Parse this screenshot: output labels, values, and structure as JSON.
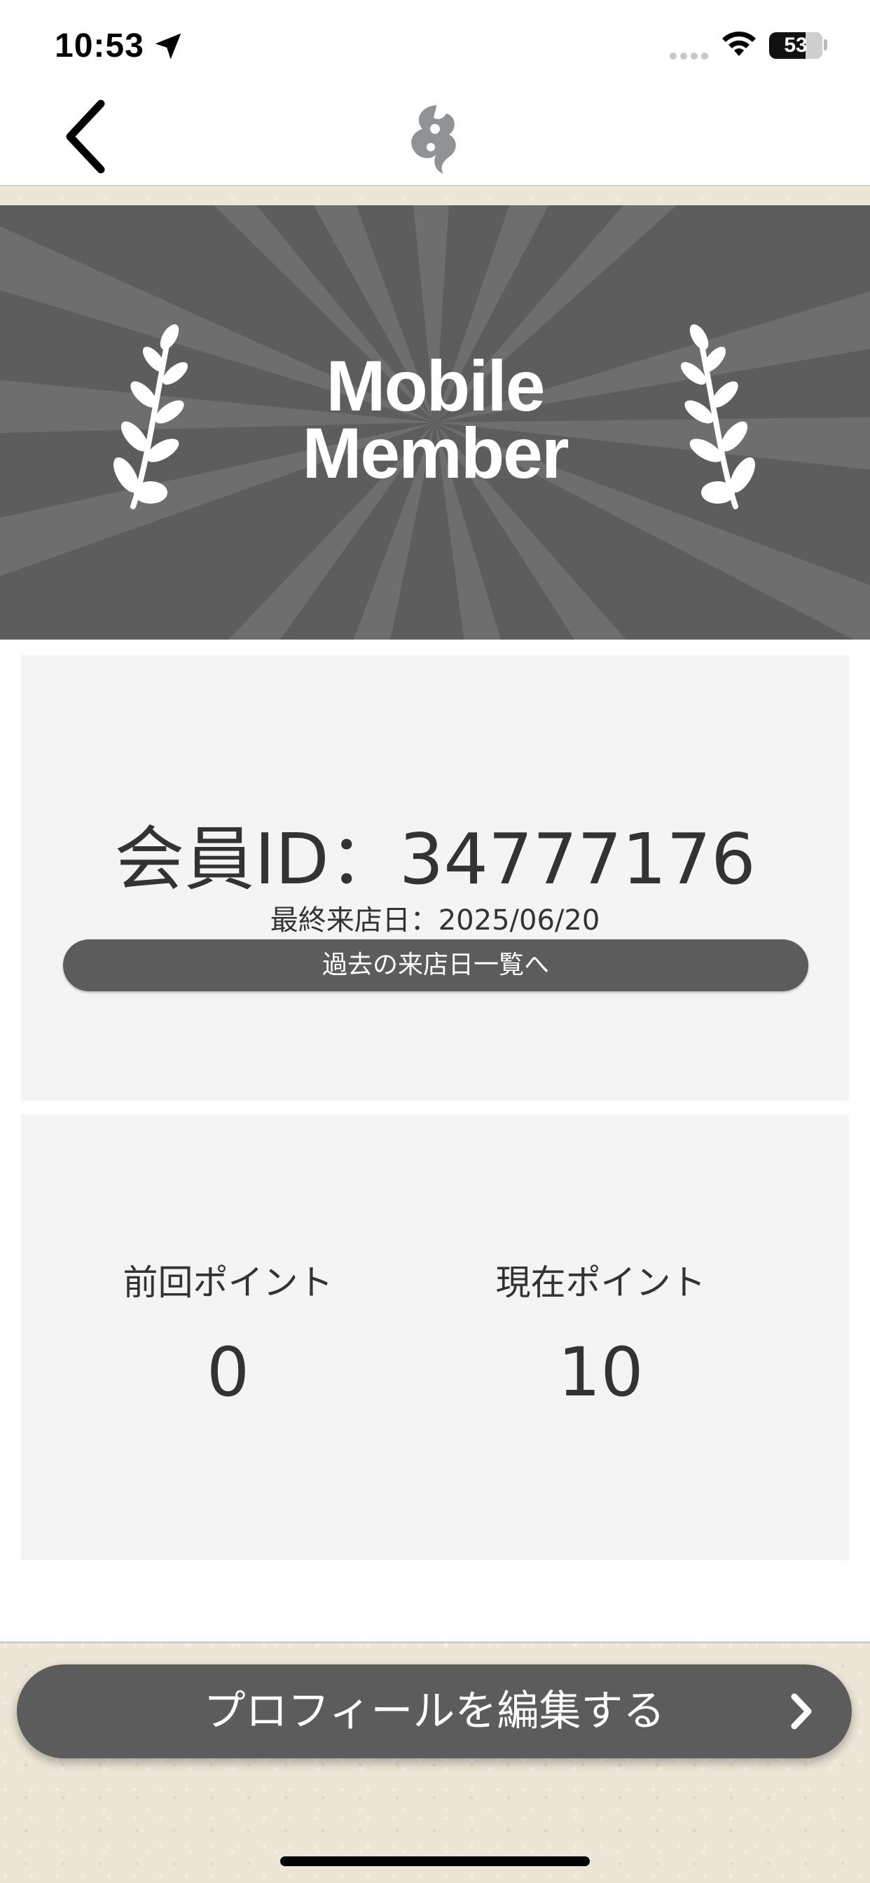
{
  "status_bar": {
    "time": "10:53",
    "battery": "53"
  },
  "banner": {
    "title_line1": "Mobile",
    "title_line2": "Member"
  },
  "member": {
    "id_text": "会員ID：34777176",
    "last_visit": "最終来店日：2025/06/20",
    "history_button_label": "過去の来店日一覧へ"
  },
  "points": {
    "previous_label": "前回ポイント",
    "previous_value": "0",
    "current_label": "現在ポイント",
    "current_value": "10"
  },
  "edit_profile": {
    "label": "プロフィールを編集する"
  },
  "colors": {
    "button_gray": "#5c5c5c",
    "card_bg": "#f4f4f4",
    "banner_dark": "#5d5d5d",
    "banner_light": "#6e6e6e"
  },
  "icons": {
    "back": "chevron-left-icon",
    "logo": "flame-logo-icon",
    "edit_chevron": "chevron-right-icon"
  }
}
